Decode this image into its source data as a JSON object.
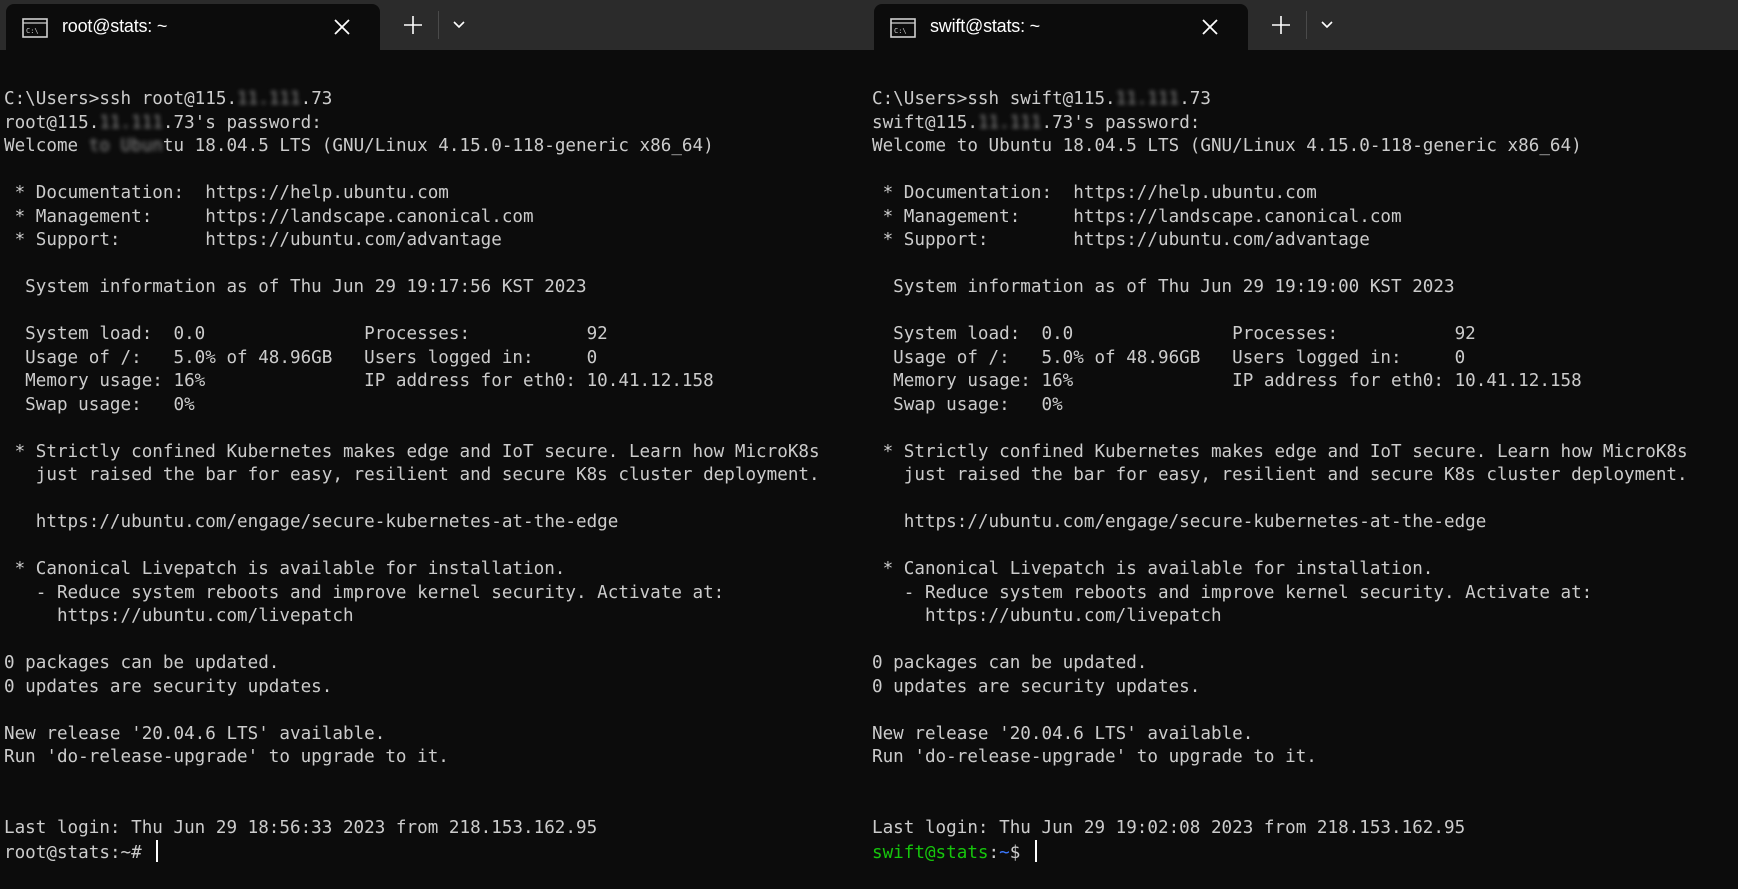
{
  "left": {
    "tab_title": "root@stats: ~",
    "lines": [
      {
        "segments": [
          {
            "text": "C:\\Users>ssh root@115."
          },
          {
            "text": "11.111",
            "blur": true
          },
          {
            "text": ".73"
          }
        ]
      },
      {
        "segments": [
          {
            "text": "root@115."
          },
          {
            "text": "11.111",
            "blur": true
          },
          {
            "text": ".73's password:"
          }
        ]
      },
      {
        "segments": [
          {
            "text": "Welcome "
          },
          {
            "text": "to Ubun",
            "blur": true
          },
          {
            "text": "tu 18.04.5 LTS (GNU/Linux 4.15.0-118-generic x86_64)"
          }
        ]
      },
      {
        "segments": []
      },
      {
        "segments": [
          {
            "text": " * Documentation:  https://help.ubuntu.com"
          }
        ]
      },
      {
        "segments": [
          {
            "text": " * Management:     https://landscape.canonical.com"
          }
        ]
      },
      {
        "segments": [
          {
            "text": " * Support:        https://ubuntu.com/advantage"
          }
        ]
      },
      {
        "segments": []
      },
      {
        "segments": [
          {
            "text": "  System information as of Thu Jun 29 19:17:56 KST 2023"
          }
        ]
      },
      {
        "segments": []
      },
      {
        "segments": [
          {
            "text": "  System load:  0.0               Processes:           92"
          }
        ]
      },
      {
        "segments": [
          {
            "text": "  Usage of /:   5.0% of 48.96GB   Users logged in:     0"
          }
        ]
      },
      {
        "segments": [
          {
            "text": "  Memory usage: 16%               IP address for eth0: 10.41.12.158"
          }
        ]
      },
      {
        "segments": [
          {
            "text": "  Swap usage:   0%"
          }
        ]
      },
      {
        "segments": []
      },
      {
        "segments": [
          {
            "text": " * Strictly confined Kubernetes makes edge and IoT secure. Learn how MicroK8s"
          }
        ]
      },
      {
        "segments": [
          {
            "text": "   just raised the bar for easy, resilient and secure K8s cluster deployment."
          }
        ]
      },
      {
        "segments": []
      },
      {
        "segments": [
          {
            "text": "   https://ubuntu.com/engage/secure-kubernetes-at-the-edge"
          }
        ]
      },
      {
        "segments": []
      },
      {
        "segments": [
          {
            "text": " * Canonical Livepatch is available for installation."
          }
        ]
      },
      {
        "segments": [
          {
            "text": "   - Reduce system reboots and improve kernel security. Activate at:"
          }
        ]
      },
      {
        "segments": [
          {
            "text": "     https://ubuntu.com/livepatch"
          }
        ]
      },
      {
        "segments": []
      },
      {
        "segments": [
          {
            "text": "0 packages can be updated."
          }
        ]
      },
      {
        "segments": [
          {
            "text": "0 updates are security updates."
          }
        ]
      },
      {
        "segments": []
      },
      {
        "segments": [
          {
            "text": "New release '20.04.6 LTS' available."
          }
        ]
      },
      {
        "segments": [
          {
            "text": "Run 'do-release-upgrade' to upgrade to it."
          }
        ]
      },
      {
        "segments": []
      },
      {
        "segments": []
      },
      {
        "segments": [
          {
            "text": "Last login: Thu Jun 29 18:56:33 2023 from 218.153.162.95"
          }
        ]
      }
    ],
    "prompt": {
      "user": "root@stats",
      "sep": ":",
      "path": "~",
      "symbol": "# ",
      "colored": false
    }
  },
  "right": {
    "tab_title": "swift@stats: ~",
    "lines": [
      {
        "segments": [
          {
            "text": "C:\\Users>ssh swift@115."
          },
          {
            "text": "11.111",
            "blur": true
          },
          {
            "text": ".73"
          }
        ]
      },
      {
        "segments": [
          {
            "text": "swift@115."
          },
          {
            "text": "11.111",
            "blur": true
          },
          {
            "text": ".73's password:"
          }
        ]
      },
      {
        "segments": [
          {
            "text": "Welcome to Ubuntu 18.04.5 LTS (GNU/Linux 4.15.0-118-generic x86_64)"
          }
        ]
      },
      {
        "segments": []
      },
      {
        "segments": [
          {
            "text": " * Documentation:  https://help.ubuntu.com"
          }
        ]
      },
      {
        "segments": [
          {
            "text": " * Management:     https://landscape.canonical.com"
          }
        ]
      },
      {
        "segments": [
          {
            "text": " * Support:        https://ubuntu.com/advantage"
          }
        ]
      },
      {
        "segments": []
      },
      {
        "segments": [
          {
            "text": "  System information as of Thu Jun 29 19:19:00 KST 2023"
          }
        ]
      },
      {
        "segments": []
      },
      {
        "segments": [
          {
            "text": "  System load:  0.0               Processes:           92"
          }
        ]
      },
      {
        "segments": [
          {
            "text": "  Usage of /:   5.0% of 48.96GB   Users logged in:     0"
          }
        ]
      },
      {
        "segments": [
          {
            "text": "  Memory usage: 16%               IP address for eth0: 10.41.12.158"
          }
        ]
      },
      {
        "segments": [
          {
            "text": "  Swap usage:   0%"
          }
        ]
      },
      {
        "segments": []
      },
      {
        "segments": [
          {
            "text": " * Strictly confined Kubernetes makes edge and IoT secure. Learn how MicroK8s"
          }
        ]
      },
      {
        "segments": [
          {
            "text": "   just raised the bar for easy, resilient and secure K8s cluster deployment."
          }
        ]
      },
      {
        "segments": []
      },
      {
        "segments": [
          {
            "text": "   https://ubuntu.com/engage/secure-kubernetes-at-the-edge"
          }
        ]
      },
      {
        "segments": []
      },
      {
        "segments": [
          {
            "text": " * Canonical Livepatch is available for installation."
          }
        ]
      },
      {
        "segments": [
          {
            "text": "   - Reduce system reboots and improve kernel security. Activate at:"
          }
        ]
      },
      {
        "segments": [
          {
            "text": "     https://ubuntu.com/livepatch"
          }
        ]
      },
      {
        "segments": []
      },
      {
        "segments": [
          {
            "text": "0 packages can be updated."
          }
        ]
      },
      {
        "segments": [
          {
            "text": "0 updates are security updates."
          }
        ]
      },
      {
        "segments": []
      },
      {
        "segments": [
          {
            "text": "New release '20.04.6 LTS' available."
          }
        ]
      },
      {
        "segments": [
          {
            "text": "Run 'do-release-upgrade' to upgrade to it."
          }
        ]
      },
      {
        "segments": []
      },
      {
        "segments": []
      },
      {
        "segments": [
          {
            "text": "Last login: Thu Jun 29 19:02:08 2023 from 218.153.162.95"
          }
        ]
      }
    ],
    "prompt": {
      "user": "swift@stats",
      "sep": ":",
      "path": "~",
      "symbol": "$ ",
      "colored": true
    }
  },
  "icons": {
    "tab": "terminal-icon",
    "close": "close-icon",
    "new_tab": "plus-icon",
    "dropdown": "chevron-down-icon"
  },
  "colors": {
    "terminal_bg": "#0c0c0c",
    "terminal_fg": "#cccccc",
    "tabbar_bg": "#2b2b2b",
    "prompt_user": "#16c60c",
    "prompt_path": "#3b78ff"
  }
}
